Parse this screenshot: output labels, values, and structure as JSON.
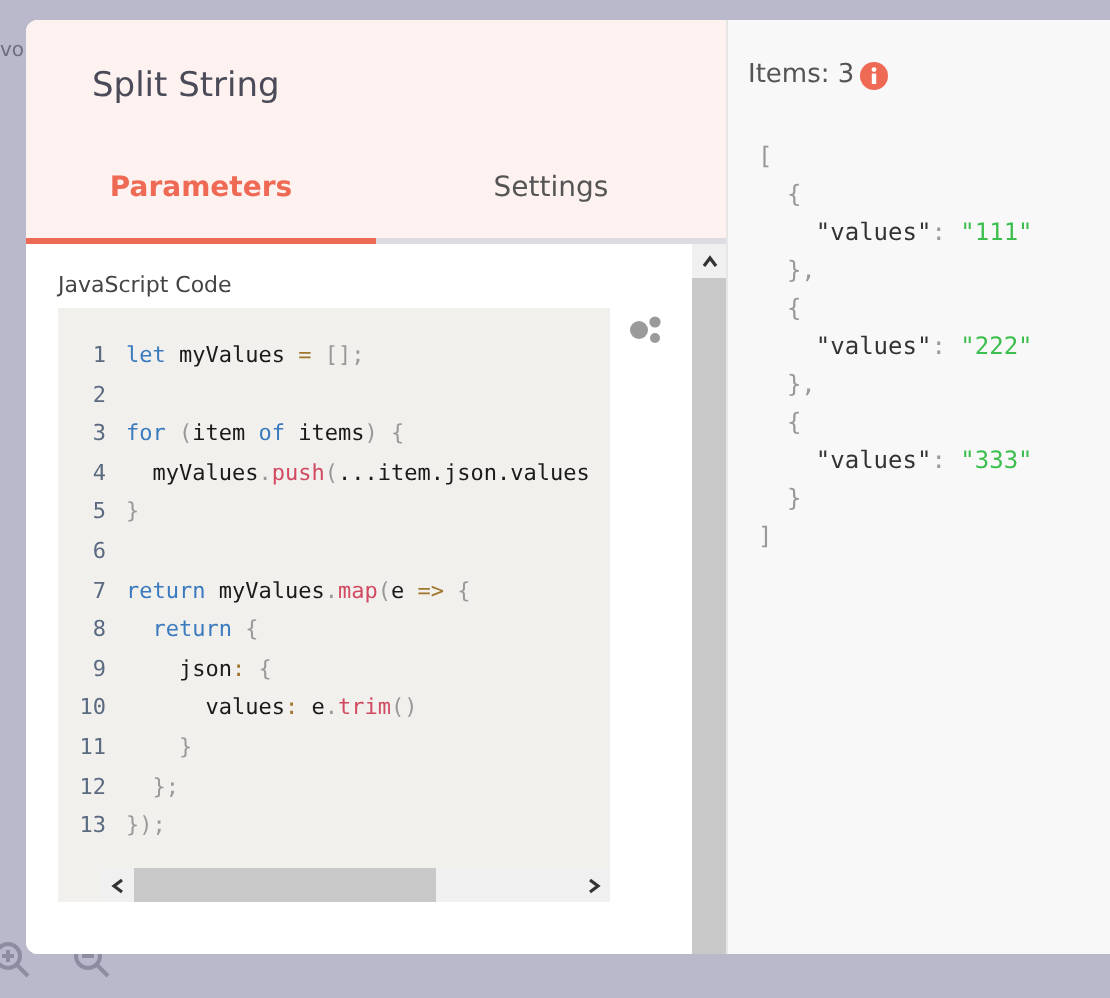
{
  "background_text": "vo",
  "node": {
    "title": "Split String"
  },
  "tabs": [
    {
      "label": "Parameters",
      "selected": true
    },
    {
      "label": "Settings",
      "selected": false
    }
  ],
  "field": {
    "label": "JavaScript Code"
  },
  "code_lines": [
    {
      "number": "1",
      "tokens": [
        {
          "text": "let",
          "kind": "keyword"
        },
        {
          "text": " myValues ",
          "kind": "plain"
        },
        {
          "text": "=",
          "kind": "operator"
        },
        {
          "text": " [];",
          "kind": "punct"
        }
      ]
    },
    {
      "number": "2"
    },
    {
      "number": "3",
      "tokens": [
        {
          "text": "for",
          "kind": "keyword"
        },
        {
          "text": " (",
          "kind": "punct"
        },
        {
          "text": "item ",
          "kind": "plain"
        },
        {
          "text": "of",
          "kind": "keyword"
        },
        {
          "text": " items",
          "kind": "plain"
        },
        {
          "text": ") {",
          "kind": "punct"
        }
      ]
    },
    {
      "number": "4",
      "tokens": [
        {
          "text": "  myValues",
          "kind": "plain"
        },
        {
          "text": ".",
          "kind": "punct"
        },
        {
          "text": "push",
          "kind": "method"
        },
        {
          "text": "(",
          "kind": "punct"
        },
        {
          "text": "...item.json.values",
          "kind": "plain"
        }
      ]
    },
    {
      "number": "5",
      "tokens": [
        {
          "text": "}",
          "kind": "punct"
        }
      ]
    },
    {
      "number": "6"
    },
    {
      "number": "7",
      "tokens": [
        {
          "text": "return",
          "kind": "keyword"
        },
        {
          "text": " myValues",
          "kind": "plain"
        },
        {
          "text": ".",
          "kind": "punct"
        },
        {
          "text": "map",
          "kind": "method"
        },
        {
          "text": "(",
          "kind": "punct"
        },
        {
          "text": "e ",
          "kind": "plain"
        },
        {
          "text": "=>",
          "kind": "operator"
        },
        {
          "text": " {",
          "kind": "punct"
        }
      ]
    },
    {
      "number": "8",
      "tokens": [
        {
          "text": "  return",
          "kind": "keyword"
        },
        {
          "text": " {",
          "kind": "punct"
        }
      ]
    },
    {
      "number": "9",
      "tokens": [
        {
          "text": "    json",
          "kind": "plain"
        },
        {
          "text": ":",
          "kind": "operator"
        },
        {
          "text": " {",
          "kind": "punct"
        }
      ]
    },
    {
      "number": "10",
      "tokens": [
        {
          "text": "      values",
          "kind": "plain"
        },
        {
          "text": ":",
          "kind": "operator"
        },
        {
          "text": " e",
          "kind": "plain"
        },
        {
          "text": ".",
          "kind": "punct"
        },
        {
          "text": "trim",
          "kind": "method"
        },
        {
          "text": "()",
          "kind": "punct"
        }
      ]
    },
    {
      "number": "11",
      "tokens": [
        {
          "text": "    }",
          "kind": "punct"
        }
      ]
    },
    {
      "number": "12",
      "tokens": [
        {
          "text": "  };",
          "kind": "punct"
        }
      ]
    },
    {
      "number": "13",
      "tokens": [
        {
          "text": "});",
          "kind": "punct"
        }
      ]
    }
  ],
  "output": {
    "count_label": "Items: 3",
    "lines": [
      {
        "tokens": [
          {
            "text": "[",
            "kind": "punct"
          }
        ]
      },
      {
        "tokens": [
          {
            "text": "  {",
            "kind": "punct"
          }
        ]
      },
      {
        "tokens": [
          {
            "text": "    \"values\"",
            "kind": "key"
          },
          {
            "text": ": ",
            "kind": "punct"
          },
          {
            "text": "\"111\"",
            "kind": "string"
          }
        ]
      },
      {
        "tokens": [
          {
            "text": "  },",
            "kind": "punct"
          }
        ]
      },
      {
        "tokens": [
          {
            "text": "  {",
            "kind": "punct"
          }
        ]
      },
      {
        "tokens": [
          {
            "text": "    \"values\"",
            "kind": "key"
          },
          {
            "text": ": ",
            "kind": "punct"
          },
          {
            "text": "\"222\"",
            "kind": "string"
          }
        ]
      },
      {
        "tokens": [
          {
            "text": "  },",
            "kind": "punct"
          }
        ]
      },
      {
        "tokens": [
          {
            "text": "  {",
            "kind": "punct"
          }
        ]
      },
      {
        "tokens": [
          {
            "text": "    \"values\"",
            "kind": "key"
          },
          {
            "text": ": ",
            "kind": "punct"
          },
          {
            "text": "\"333\"",
            "kind": "string"
          }
        ]
      },
      {
        "tokens": [
          {
            "text": "  }",
            "kind": "punct"
          }
        ]
      },
      {
        "tokens": [
          {
            "text": "]",
            "kind": "punct"
          }
        ]
      }
    ]
  }
}
